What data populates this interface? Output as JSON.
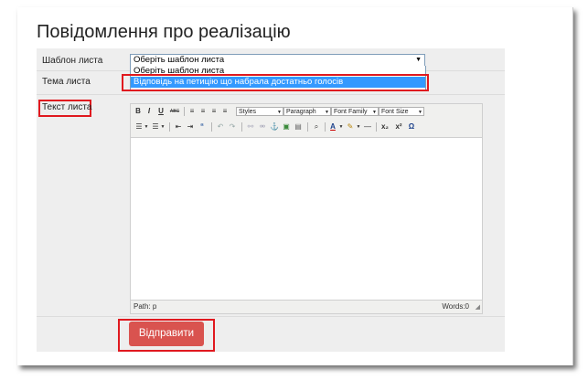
{
  "page": {
    "title": "Повідомлення про реалізацію"
  },
  "form": {
    "template_label": "Шаблон листа",
    "template_select": {
      "value": "Оберіть шаблон листа",
      "options": [
        "Оберіть шаблон листа",
        "Відповідь на петицію що набрала достатньо голосів"
      ],
      "highlighted_index": 1
    },
    "subject_label": "Тема листа",
    "body_label": "Текст листа",
    "submit_label": "Відправити"
  },
  "editor": {
    "toolbar": {
      "bold": "B",
      "italic": "I",
      "underline": "U",
      "strike": "ABC",
      "styles": "Styles",
      "paragraph": "Paragraph",
      "font_family": "Font Family",
      "font_size": "Font Size",
      "subscript": "x₂",
      "superscript": "x²",
      "omega": "Ω"
    },
    "status_path": "Path: p",
    "word_count": "Words:0"
  },
  "colors": {
    "accent_red": "#d9534f",
    "highlight_blue": "#3399ff",
    "annotation_red": "#e0191f"
  }
}
